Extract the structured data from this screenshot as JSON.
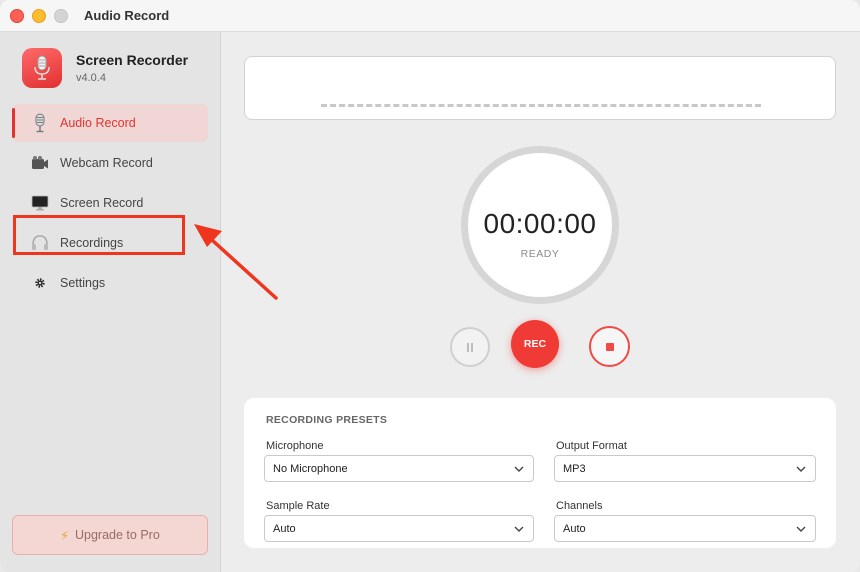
{
  "window": {
    "title": "Audio Record"
  },
  "app": {
    "name": "Screen Recorder",
    "version": "v4.0.4"
  },
  "sidebar": {
    "items": [
      {
        "label": "Audio Record",
        "icon": "microphone-icon",
        "active": true
      },
      {
        "label": "Webcam Record",
        "icon": "webcam-icon",
        "active": false
      },
      {
        "label": "Screen Record",
        "icon": "monitor-icon",
        "active": false
      },
      {
        "label": "Recordings",
        "icon": "headphones-icon",
        "active": false
      },
      {
        "label": "Settings",
        "icon": "gear-icon",
        "active": false
      }
    ],
    "upgrade": {
      "label": "Upgrade to Pro",
      "icon": "lightning-icon"
    }
  },
  "timer": {
    "value": "00:00:00",
    "status": "READY"
  },
  "controls": {
    "rec_label": "REC"
  },
  "presets": {
    "title": "RECORDING PRESETS",
    "microphone": {
      "label": "Microphone",
      "value": "No Microphone"
    },
    "output_format": {
      "label": "Output Format",
      "value": "MP3"
    },
    "sample_rate": {
      "label": "Sample Rate",
      "value": "Auto"
    },
    "channels": {
      "label": "Channels",
      "value": "Auto"
    }
  },
  "colors": {
    "accent": "#e5322d",
    "annotation": "#f0351e",
    "rec": "#f03a35"
  }
}
